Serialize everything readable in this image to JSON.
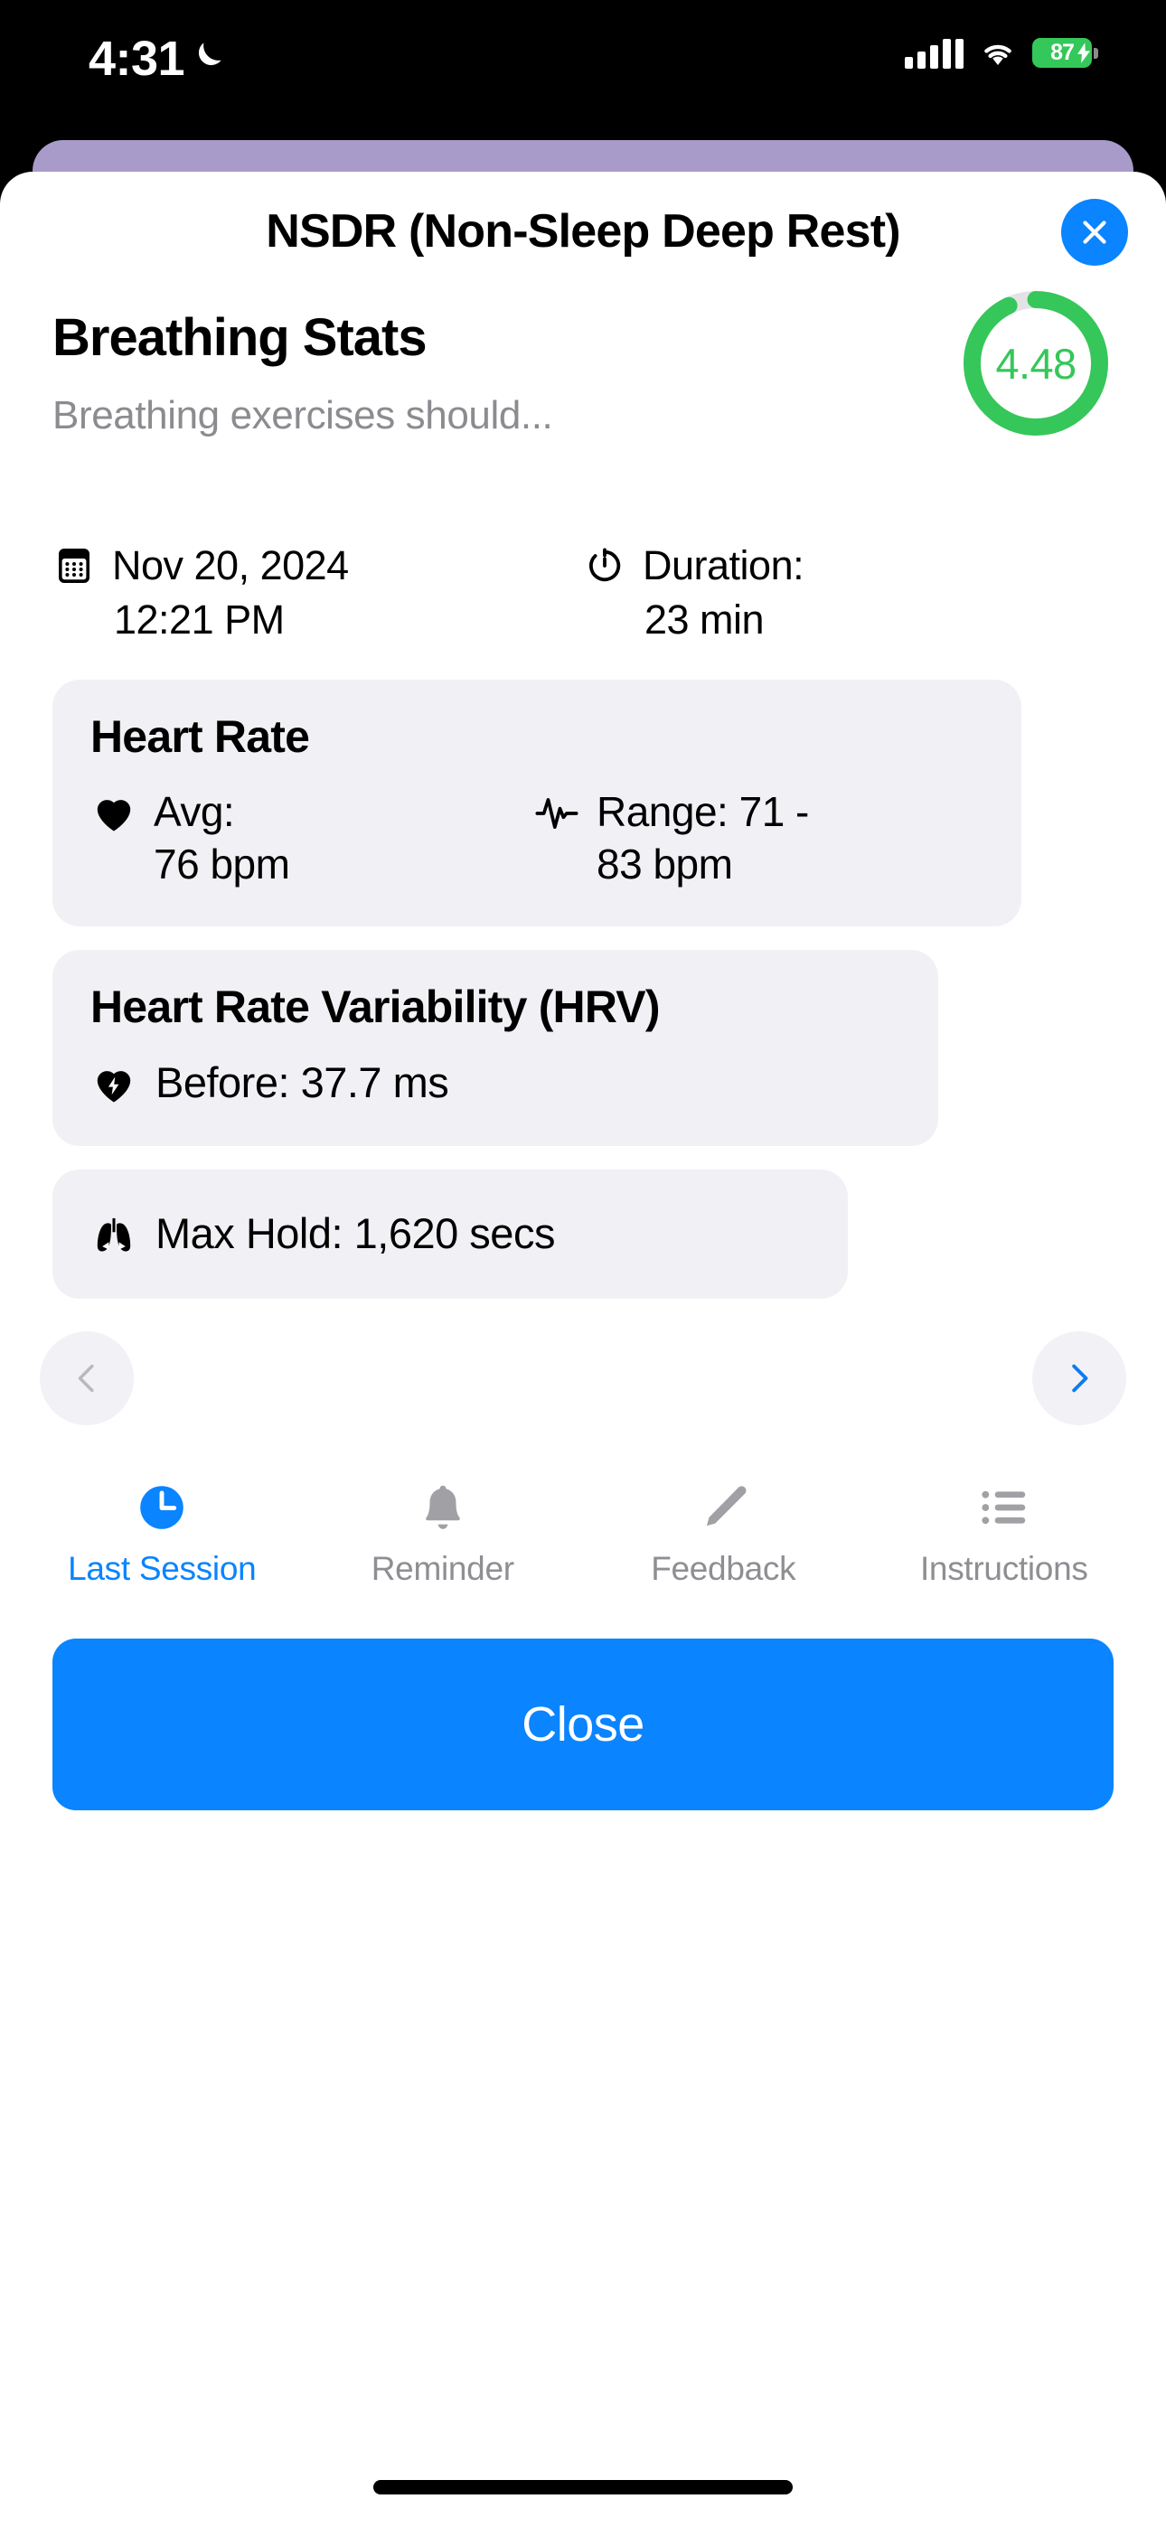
{
  "status_bar": {
    "time": "4:31",
    "dnd_icon": "moon-icon",
    "signal_icon": "cellular-signal-icon",
    "wifi_icon": "wifi-icon",
    "battery_percent": "87",
    "battery_charging_icon": "lightning-bolt-icon"
  },
  "modal": {
    "title": "NSDR (Non-Sleep Deep Rest)",
    "close_icon": "close-x-icon"
  },
  "stats": {
    "heading": "Breathing Stats",
    "subtitle": "Breathing exercises should...",
    "score": "4.48",
    "score_progress_percent": 93,
    "ring_color": "#35C759",
    "ring_track_color": "#E3E3E5"
  },
  "meta": {
    "date_icon": "calendar-icon",
    "date": "Nov 20, 2024",
    "time": "12:21 PM",
    "duration_icon": "stopwatch-icon",
    "duration_label": "Duration:",
    "duration_value": "23 min"
  },
  "cards": {
    "heart_rate": {
      "title": "Heart Rate",
      "avg_icon": "heart-icon",
      "avg_label": "Avg:",
      "avg_value": "76 bpm",
      "range_icon": "heartbeat-waveform-icon",
      "range_label": "Range: 71 -",
      "range_value": "83 bpm"
    },
    "hrv": {
      "title": "Heart Rate Variability (HRV)",
      "icon": "heart-bolt-icon",
      "text": "Before: 37.7 ms"
    },
    "max_hold": {
      "icon": "lungs-icon",
      "text": "Max Hold: 1,620 secs"
    }
  },
  "pager": {
    "prev_icon": "chevron-left-icon",
    "next_icon": "chevron-right-icon",
    "prev_enabled": false,
    "next_enabled": true,
    "disabled_color": "#B8B8BD",
    "enabled_color": "#0A84FF"
  },
  "tabs": [
    {
      "label": "Last Session",
      "icon": "clock-icon",
      "active": true
    },
    {
      "label": "Reminder",
      "icon": "bell-icon",
      "active": false
    },
    {
      "label": "Feedback",
      "icon": "pencil-icon",
      "active": false
    },
    {
      "label": "Instructions",
      "icon": "list-icon",
      "active": false
    }
  ],
  "footer": {
    "close_label": "Close",
    "accent_color": "#0A84FF"
  }
}
